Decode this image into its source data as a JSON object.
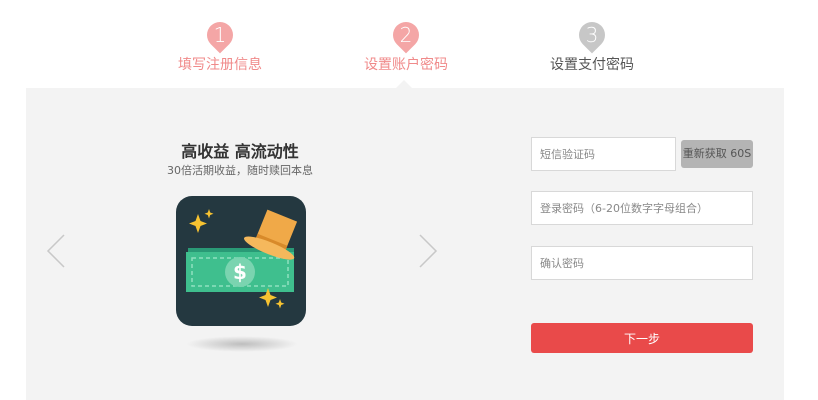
{
  "steps": [
    {
      "number": "1",
      "label": "填写注册信息",
      "state": "done"
    },
    {
      "number": "2",
      "label": "设置账户密码",
      "state": "done"
    },
    {
      "number": "3",
      "label": "设置支付密码",
      "state": "current"
    }
  ],
  "promo": {
    "title": "高收益  高流动性",
    "subtitle": "30倍活期收益，随时赎回本息"
  },
  "form": {
    "sms_placeholder": "短信验证码",
    "resend_label": "重新获取 60S",
    "password_placeholder": "登录密码（6-20位数字字母组合）",
    "confirm_placeholder": "确认密码",
    "next_label": "下一步"
  },
  "colors": {
    "step_active": "#f4a6a6",
    "step_inactive": "#c7c7c7",
    "primary": "#e94a4a",
    "panel_bg": "#f3f3f3"
  },
  "icons": [
    "chevron-left-icon",
    "chevron-right-icon",
    "money-hat-icon"
  ]
}
